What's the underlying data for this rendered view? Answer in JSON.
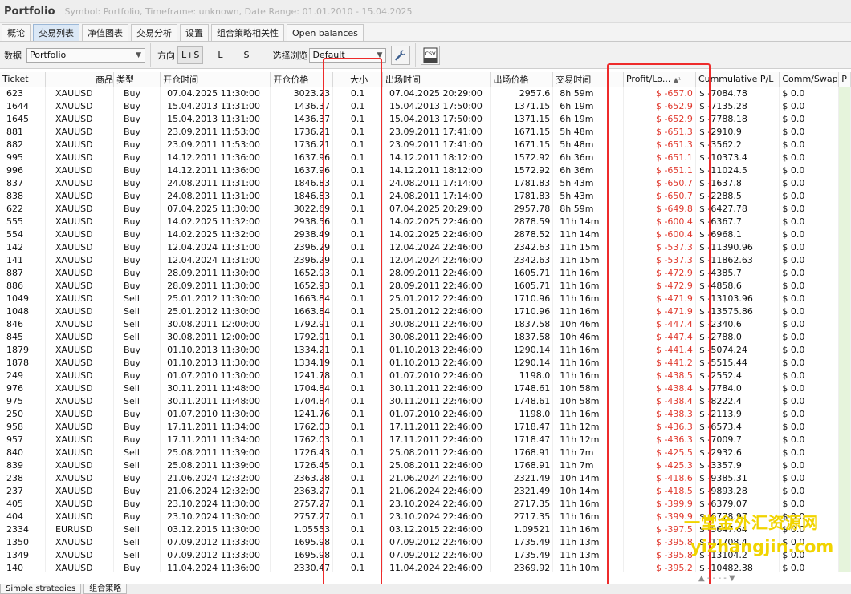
{
  "title": {
    "app": "Portfolio",
    "subtitle": "Symbol: Portfolio, Timeframe: unknown, Date Range: 01.01.2010 - 15.04.2025"
  },
  "tabs": [
    "概论",
    "交易列表",
    "净值图表",
    "交易分析",
    "设置",
    "组合策略相关性",
    "Open balances"
  ],
  "toolbar": {
    "data_label": "数据",
    "data_value": "Portfolio",
    "direction_label": "方向",
    "dir_ls": "L+S",
    "dir_l": "L",
    "dir_s": "S",
    "browse_label": "选择浏览",
    "browse_value": "Default",
    "wrench_icon": "wrench-icon",
    "csv_icon": "csv-export-icon",
    "csv_text": "CSV"
  },
  "columns": [
    "Ticket",
    "商品",
    "类型",
    "开仓时间",
    "开仓价格",
    "大小",
    "出场时间",
    "出场价格",
    "交易时间",
    "Profit/Lo...",
    "Cummulative P/L",
    "Comm/Swap",
    "P"
  ],
  "sort_indicator": "▲¹",
  "rows": [
    [
      "623",
      "XAUUSD",
      "Buy",
      "07.04.2025 11:30:00",
      "3023.23",
      "0.1",
      "07.04.2025 20:29:00",
      "2957.6",
      "8h 59m",
      "$ -657.0",
      "$ -7084.78",
      "$ 0.0"
    ],
    [
      "1644",
      "XAUUSD",
      "Buy",
      "15.04.2013 11:31:00",
      "1436.37",
      "0.1",
      "15.04.2013 17:50:00",
      "1371.15",
      "6h 19m",
      "$ -652.9",
      "$ -7135.28",
      "$ 0.0"
    ],
    [
      "1645",
      "XAUUSD",
      "Buy",
      "15.04.2013 11:31:00",
      "1436.37",
      "0.1",
      "15.04.2013 17:50:00",
      "1371.15",
      "6h 19m",
      "$ -652.9",
      "$ -7788.18",
      "$ 0.0"
    ],
    [
      "881",
      "XAUUSD",
      "Buy",
      "23.09.2011 11:53:00",
      "1736.21",
      "0.1",
      "23.09.2011 17:41:00",
      "1671.15",
      "5h 48m",
      "$ -651.3",
      "$ -2910.9",
      "$ 0.0"
    ],
    [
      "882",
      "XAUUSD",
      "Buy",
      "23.09.2011 11:53:00",
      "1736.21",
      "0.1",
      "23.09.2011 17:41:00",
      "1671.15",
      "5h 48m",
      "$ -651.3",
      "$ -3562.2",
      "$ 0.0"
    ],
    [
      "995",
      "XAUUSD",
      "Buy",
      "14.12.2011 11:36:00",
      "1637.96",
      "0.1",
      "14.12.2011 18:12:00",
      "1572.92",
      "6h 36m",
      "$ -651.1",
      "$ -10373.4",
      "$ 0.0"
    ],
    [
      "996",
      "XAUUSD",
      "Buy",
      "14.12.2011 11:36:00",
      "1637.96",
      "0.1",
      "14.12.2011 18:12:00",
      "1572.92",
      "6h 36m",
      "$ -651.1",
      "$ -11024.5",
      "$ 0.0"
    ],
    [
      "837",
      "XAUUSD",
      "Buy",
      "24.08.2011 11:31:00",
      "1846.83",
      "0.1",
      "24.08.2011 17:14:00",
      "1781.83",
      "5h 43m",
      "$ -650.7",
      "$ -1637.8",
      "$ 0.0"
    ],
    [
      "838",
      "XAUUSD",
      "Buy",
      "24.08.2011 11:31:00",
      "1846.83",
      "0.1",
      "24.08.2011 17:14:00",
      "1781.83",
      "5h 43m",
      "$ -650.7",
      "$ -2288.5",
      "$ 0.0"
    ],
    [
      "622",
      "XAUUSD",
      "Buy",
      "07.04.2025 11:30:00",
      "3022.69",
      "0.1",
      "07.04.2025 20:29:00",
      "2957.78",
      "8h 59m",
      "$ -649.8",
      "$ -6427.78",
      "$ 0.0"
    ],
    [
      "555",
      "XAUUSD",
      "Buy",
      "14.02.2025 11:32:00",
      "2938.56",
      "0.1",
      "14.02.2025 22:46:00",
      "2878.59",
      "11h 14m",
      "$ -600.4",
      "$ -6367.7",
      "$ 0.0"
    ],
    [
      "554",
      "XAUUSD",
      "Buy",
      "14.02.2025 11:32:00",
      "2938.49",
      "0.1",
      "14.02.2025 22:46:00",
      "2878.52",
      "11h 14m",
      "$ -600.4",
      "$ -6968.1",
      "$ 0.0"
    ],
    [
      "142",
      "XAUUSD",
      "Buy",
      "12.04.2024 11:31:00",
      "2396.29",
      "0.1",
      "12.04.2024 22:46:00",
      "2342.63",
      "11h 15m",
      "$ -537.3",
      "$ -11390.96",
      "$ 0.0"
    ],
    [
      "141",
      "XAUUSD",
      "Buy",
      "12.04.2024 11:31:00",
      "2396.29",
      "0.1",
      "12.04.2024 22:46:00",
      "2342.63",
      "11h 15m",
      "$ -537.3",
      "$ -11862.63",
      "$ 0.0"
    ],
    [
      "887",
      "XAUUSD",
      "Buy",
      "28.09.2011 11:30:00",
      "1652.93",
      "0.1",
      "28.09.2011 22:46:00",
      "1605.71",
      "11h 16m",
      "$ -472.9",
      "$ -4385.7",
      "$ 0.0"
    ],
    [
      "886",
      "XAUUSD",
      "Buy",
      "28.09.2011 11:30:00",
      "1652.93",
      "0.1",
      "28.09.2011 22:46:00",
      "1605.71",
      "11h 16m",
      "$ -472.9",
      "$ -4858.6",
      "$ 0.0"
    ],
    [
      "1049",
      "XAUUSD",
      "Sell",
      "25.01.2012 11:30:00",
      "1663.84",
      "0.1",
      "25.01.2012 22:46:00",
      "1710.96",
      "11h 16m",
      "$ -471.9",
      "$ -13103.96",
      "$ 0.0"
    ],
    [
      "1048",
      "XAUUSD",
      "Sell",
      "25.01.2012 11:30:00",
      "1663.84",
      "0.1",
      "25.01.2012 22:46:00",
      "1710.96",
      "11h 16m",
      "$ -471.9",
      "$ -13575.86",
      "$ 0.0"
    ],
    [
      "846",
      "XAUUSD",
      "Sell",
      "30.08.2011 12:00:00",
      "1792.91",
      "0.1",
      "30.08.2011 22:46:00",
      "1837.58",
      "10h 46m",
      "$ -447.4",
      "$ -2340.6",
      "$ 0.0"
    ],
    [
      "845",
      "XAUUSD",
      "Sell",
      "30.08.2011 12:00:00",
      "1792.91",
      "0.1",
      "30.08.2011 22:46:00",
      "1837.58",
      "10h 46m",
      "$ -447.4",
      "$ -2788.0",
      "$ 0.0"
    ],
    [
      "1879",
      "XAUUSD",
      "Buy",
      "01.10.2013 11:30:00",
      "1334.21",
      "0.1",
      "01.10.2013 22:46:00",
      "1290.14",
      "11h 16m",
      "$ -441.4",
      "$ -5074.24",
      "$ 0.0"
    ],
    [
      "1878",
      "XAUUSD",
      "Buy",
      "01.10.2013 11:30:00",
      "1334.19",
      "0.1",
      "01.10.2013 22:46:00",
      "1290.14",
      "11h 16m",
      "$ -441.2",
      "$ -5515.44",
      "$ 0.0"
    ],
    [
      "249",
      "XAUUSD",
      "Buy",
      "01.07.2010 11:30:00",
      "1241.78",
      "0.1",
      "01.07.2010 22:46:00",
      "1198.0",
      "11h 16m",
      "$ -438.5",
      "$ -2552.4",
      "$ 0.0"
    ],
    [
      "976",
      "XAUUSD",
      "Sell",
      "30.11.2011 11:48:00",
      "1704.84",
      "0.1",
      "30.11.2011 22:46:00",
      "1748.61",
      "10h 58m",
      "$ -438.4",
      "$ -7784.0",
      "$ 0.0"
    ],
    [
      "975",
      "XAUUSD",
      "Sell",
      "30.11.2011 11:48:00",
      "1704.84",
      "0.1",
      "30.11.2011 22:46:00",
      "1748.61",
      "10h 58m",
      "$ -438.4",
      "$ -8222.4",
      "$ 0.0"
    ],
    [
      "250",
      "XAUUSD",
      "Buy",
      "01.07.2010 11:30:00",
      "1241.76",
      "0.1",
      "01.07.2010 22:46:00",
      "1198.0",
      "11h 16m",
      "$ -438.3",
      "$ -2113.9",
      "$ 0.0"
    ],
    [
      "958",
      "XAUUSD",
      "Buy",
      "17.11.2011 11:34:00",
      "1762.03",
      "0.1",
      "17.11.2011 22:46:00",
      "1718.47",
      "11h 12m",
      "$ -436.3",
      "$ -6573.4",
      "$ 0.0"
    ],
    [
      "957",
      "XAUUSD",
      "Buy",
      "17.11.2011 11:34:00",
      "1762.03",
      "0.1",
      "17.11.2011 22:46:00",
      "1718.47",
      "11h 12m",
      "$ -436.3",
      "$ -7009.7",
      "$ 0.0"
    ],
    [
      "840",
      "XAUUSD",
      "Sell",
      "25.08.2011 11:39:00",
      "1726.43",
      "0.1",
      "25.08.2011 22:46:00",
      "1768.91",
      "11h 7m",
      "$ -425.5",
      "$ -2932.6",
      "$ 0.0"
    ],
    [
      "839",
      "XAUUSD",
      "Sell",
      "25.08.2011 11:39:00",
      "1726.45",
      "0.1",
      "25.08.2011 22:46:00",
      "1768.91",
      "11h 7m",
      "$ -425.3",
      "$ -3357.9",
      "$ 0.0"
    ],
    [
      "238",
      "XAUUSD",
      "Buy",
      "21.06.2024 12:32:00",
      "2363.28",
      "0.1",
      "21.06.2024 22:46:00",
      "2321.49",
      "10h 14m",
      "$ -418.6",
      "$ -9385.31",
      "$ 0.0"
    ],
    [
      "237",
      "XAUUSD",
      "Buy",
      "21.06.2024 12:32:00",
      "2363.27",
      "0.1",
      "21.06.2024 22:46:00",
      "2321.49",
      "10h 14m",
      "$ -418.5",
      "$ -9893.28",
      "$ 0.0"
    ],
    [
      "405",
      "XAUUSD",
      "Buy",
      "23.10.2024 11:30:00",
      "2757.27",
      "0.1",
      "23.10.2024 22:46:00",
      "2717.35",
      "11h 16m",
      "$ -399.9",
      "$ -6379.07",
      "$ 0.0"
    ],
    [
      "404",
      "XAUUSD",
      "Buy",
      "23.10.2024 11:30:00",
      "2757.27",
      "0.1",
      "23.10.2024 22:46:00",
      "2717.35",
      "11h 16m",
      "$ -399.9",
      "$ -6778.97",
      "$ 0.0"
    ],
    [
      "2334",
      "EURUSD",
      "Sell",
      "03.12.2015 11:30:00",
      "1.05553",
      "0.1",
      "03.12.2015 22:46:00",
      "1.09521",
      "11h 16m",
      "$ -397.5",
      "$ -5647.64",
      "$ 0.0"
    ],
    [
      "1350",
      "XAUUSD",
      "Sell",
      "07.09.2012 11:33:00",
      "1695.98",
      "0.1",
      "07.09.2012 22:46:00",
      "1735.49",
      "11h 13m",
      "$ -395.8",
      "$ -12708.4",
      "$ 0.0"
    ],
    [
      "1349",
      "XAUUSD",
      "Sell",
      "07.09.2012 11:33:00",
      "1695.98",
      "0.1",
      "07.09.2012 22:46:00",
      "1735.49",
      "11h 13m",
      "$ -395.8",
      "$ -13104.2",
      "$ 0.0"
    ],
    [
      "140",
      "XAUUSD",
      "Buy",
      "11.04.2024 11:36:00",
      "2330.47",
      "0.1",
      "11.04.2024 22:46:00",
      "2369.92",
      "11h 10m",
      "$ -395.2",
      "$ -10482.38",
      "$ 0.0"
    ]
  ],
  "bottom_tabs": [
    "Simple strategies",
    "组合策略"
  ],
  "watermark": {
    "line1": "一堂金外汇资源网",
    "line2": "yiz⁠hangjin.com"
  },
  "colors": {
    "loss": "#e03a2f",
    "highlight_box": "#ee2b2b",
    "active_tab": "#dbe8f6",
    "watermark": "#f1d400"
  }
}
